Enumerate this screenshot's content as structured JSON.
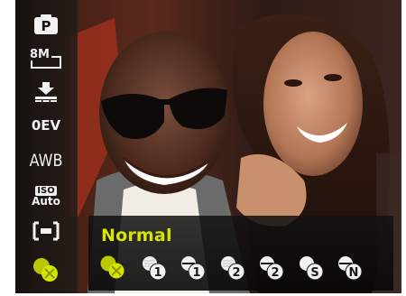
{
  "sidebar": {
    "items": [
      {
        "icon": "program-mode-icon",
        "label": "P"
      },
      {
        "icon": "image-size-icon",
        "label": "8M"
      },
      {
        "icon": "quality-icon",
        "label": ""
      },
      {
        "icon": "exposure-icon",
        "label": "0EV"
      },
      {
        "icon": "white-balance-icon",
        "label": "AWB"
      },
      {
        "icon": "iso-icon",
        "label_top": "ISO",
        "label_bottom": "Auto"
      },
      {
        "icon": "metering-icon",
        "label": ""
      },
      {
        "icon": "color-mode-icon",
        "label": ""
      }
    ]
  },
  "panel": {
    "title": "Normal",
    "options": [
      {
        "icon": "color-normal-icon",
        "selected": true
      },
      {
        "icon": "color-vivid-1-icon",
        "badge": "1"
      },
      {
        "icon": "color-soft-1-icon",
        "badge": "1"
      },
      {
        "icon": "color-vivid-2-icon",
        "badge": "2"
      },
      {
        "icon": "color-soft-2-icon",
        "badge": "2"
      },
      {
        "icon": "color-sepia-icon",
        "badge": "S"
      },
      {
        "icon": "color-bw-icon",
        "badge": "N"
      }
    ]
  },
  "colors": {
    "accent": "#d7e600",
    "icon_white": "#f2f2f2",
    "sidebar_bg": "#1a1411"
  }
}
